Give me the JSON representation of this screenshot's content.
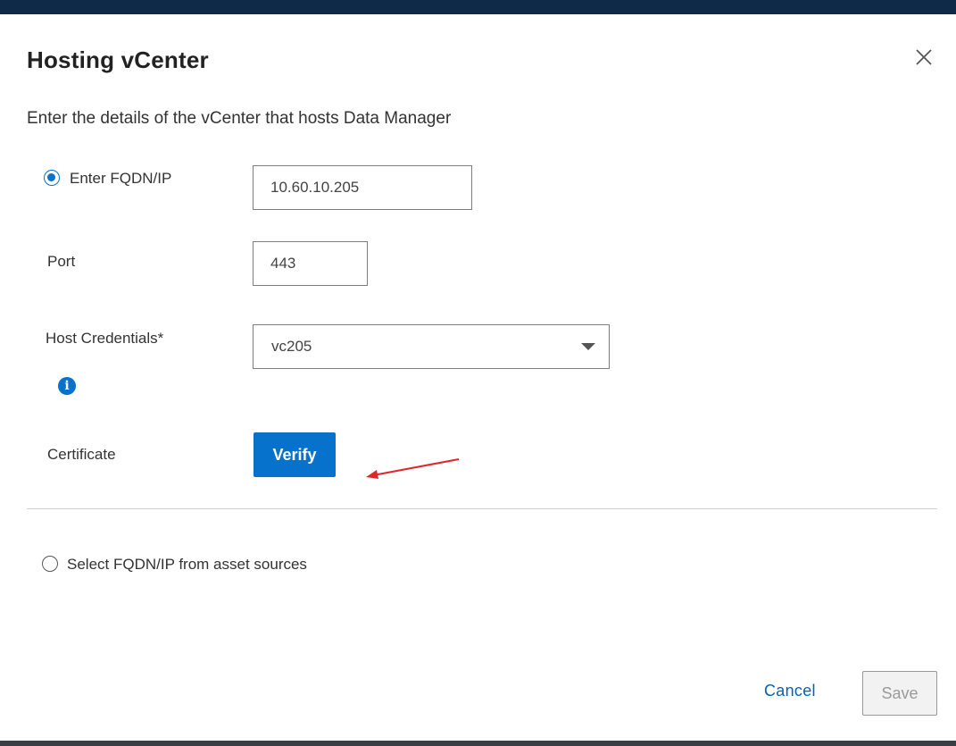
{
  "dialog": {
    "title": "Hosting vCenter",
    "subtitle": "Enter the details of the vCenter that hosts Data Manager"
  },
  "options": {
    "fqdn_label": "Enter FQDN/IP",
    "fqdn_selected": true,
    "asset_sources_label": "Select FQDN/IP from asset sources",
    "asset_sources_selected": false
  },
  "fields": {
    "fqdn_value": "10.60.10.205",
    "port_label": "Port",
    "port_value": "443",
    "credentials_label": "Host Credentials*",
    "credentials_value": "vc205",
    "certificate_label": "Certificate"
  },
  "buttons": {
    "verify": "Verify",
    "cancel": "Cancel",
    "save": "Save"
  },
  "icons": {
    "close": "close-icon",
    "info": "info-icon",
    "dropdown": "chevron-down-icon",
    "annotation": "red-arrow-annotation"
  },
  "colors": {
    "accent": "#0672cb",
    "link": "#0063b8",
    "annotation": "#e0262b"
  }
}
